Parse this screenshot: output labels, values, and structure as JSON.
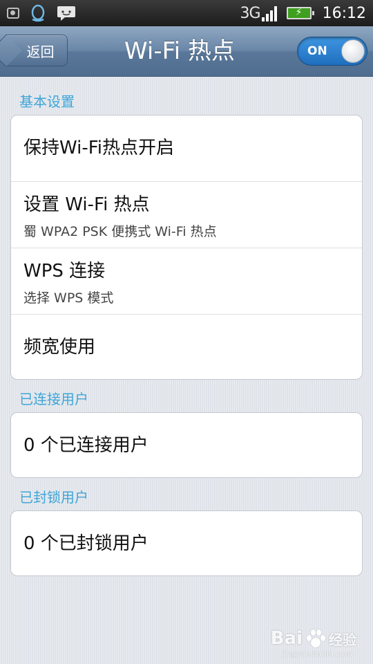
{
  "status_bar": {
    "network": "3G",
    "time": "16:12",
    "icons": [
      "camera-icon",
      "qq-penguin-icon",
      "message-icon",
      "signal-icon",
      "battery-charging-icon"
    ],
    "signal_level": 1.0
  },
  "header": {
    "back_label": "返回",
    "title": "Wi-Fi 热点",
    "toggle_label": "ON",
    "toggle_state": true
  },
  "sections": {
    "basic": {
      "header": "基本设置",
      "items": [
        {
          "title": "保持Wi-Fi热点开启"
        },
        {
          "title": "设置 Wi-Fi 热点",
          "subtitle": "蜀 WPA2 PSK 便携式 Wi-Fi 热点"
        },
        {
          "title": "WPS 连接",
          "subtitle": "选择 WPS 模式"
        },
        {
          "title": "频宽使用"
        }
      ]
    },
    "connected": {
      "header": "已连接用户",
      "items": [
        {
          "title": "0 个已连接用户"
        }
      ]
    },
    "blocked": {
      "header": "已封锁用户",
      "items": [
        {
          "title": "0 个已封锁用户"
        }
      ]
    }
  },
  "watermark": {
    "brand": "Bai",
    "suffix": "经验",
    "url": "jingyan.baidu.com"
  },
  "colors": {
    "accent_blue": "#3fa5d8",
    "title_bar": "#6a87a8",
    "toggle_on": "#2f86d4",
    "background": "#dfe3e9"
  }
}
